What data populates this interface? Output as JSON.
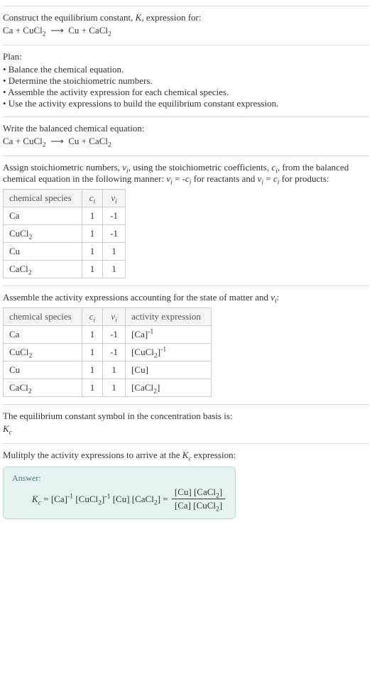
{
  "intro": {
    "line1": "Construct the equilibrium constant, K, expression for:",
    "equation": "Ca + CuCl₂ ⟶ Cu + CaCl₂"
  },
  "plan": {
    "title": "Plan:",
    "items": [
      "• Balance the chemical equation.",
      "• Determine the stoichiometric numbers.",
      "• Assemble the activity expression for each chemical species.",
      "• Use the activity expressions to build the equilibrium constant expression."
    ]
  },
  "balanced": {
    "prompt": "Write the balanced chemical equation:",
    "equation": "Ca + CuCl₂ ⟶ Cu + CaCl₂"
  },
  "assign": {
    "prompt": "Assign stoichiometric numbers, νᵢ, using the stoichiometric coefficients, cᵢ, from the balanced chemical equation in the following manner: νᵢ = -cᵢ for reactants and νᵢ = cᵢ for products:",
    "headers": {
      "species": "chemical species",
      "ci": "cᵢ",
      "vi": "νᵢ"
    },
    "rows": [
      {
        "species": "Ca",
        "ci": "1",
        "vi": "-1"
      },
      {
        "species": "CuCl₂",
        "ci": "1",
        "vi": "-1"
      },
      {
        "species": "Cu",
        "ci": "1",
        "vi": "1"
      },
      {
        "species": "CaCl₂",
        "ci": "1",
        "vi": "1"
      }
    ]
  },
  "activity": {
    "prompt": "Assemble the activity expressions accounting for the state of matter and νᵢ:",
    "headers": {
      "species": "chemical species",
      "ci": "cᵢ",
      "vi": "νᵢ",
      "expr": "activity expression"
    },
    "rows": [
      {
        "species": "Ca",
        "ci": "1",
        "vi": "-1",
        "expr": "[Ca]⁻¹"
      },
      {
        "species": "CuCl₂",
        "ci": "1",
        "vi": "-1",
        "expr": "[CuCl₂]⁻¹"
      },
      {
        "species": "Cu",
        "ci": "1",
        "vi": "1",
        "expr": "[Cu]"
      },
      {
        "species": "CaCl₂",
        "ci": "1",
        "vi": "1",
        "expr": "[CaCl₂]"
      }
    ]
  },
  "symbol": {
    "prompt": "The equilibrium constant symbol in the concentration basis is:",
    "value": "K𝑐"
  },
  "multiply": {
    "prompt": "Mulitply the activity expressions to arrive at the K𝑐 expression:"
  },
  "answer": {
    "label": "Answer:",
    "lhs": "K𝑐 = [Ca]⁻¹ [CuCl₂]⁻¹ [Cu] [CaCl₂] =",
    "num": "[Cu] [CaCl₂]",
    "den": "[Ca] [CuCl₂]"
  },
  "chart_data": {
    "type": "table",
    "tables": [
      {
        "title": "Stoichiometric numbers",
        "columns": [
          "chemical species",
          "c_i",
          "ν_i"
        ],
        "rows": [
          [
            "Ca",
            1,
            -1
          ],
          [
            "CuCl2",
            1,
            -1
          ],
          [
            "Cu",
            1,
            1
          ],
          [
            "CaCl2",
            1,
            1
          ]
        ]
      },
      {
        "title": "Activity expressions",
        "columns": [
          "chemical species",
          "c_i",
          "ν_i",
          "activity expression"
        ],
        "rows": [
          [
            "Ca",
            1,
            -1,
            "[Ca]^-1"
          ],
          [
            "CuCl2",
            1,
            -1,
            "[CuCl2]^-1"
          ],
          [
            "Cu",
            1,
            1,
            "[Cu]"
          ],
          [
            "CaCl2",
            1,
            1,
            "[CaCl2]"
          ]
        ]
      }
    ],
    "equilibrium_expression": "K_c = [Cu][CaCl2] / ([Ca][CuCl2])"
  }
}
